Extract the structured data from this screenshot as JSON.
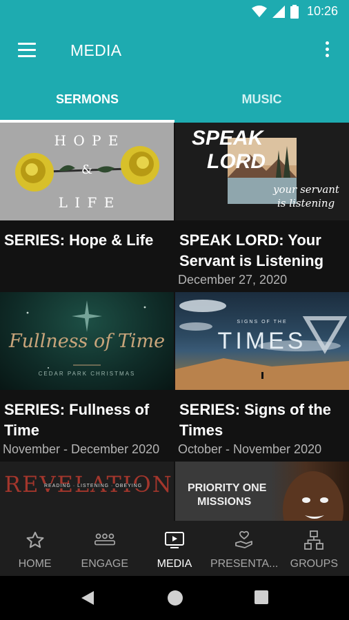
{
  "status_bar": {
    "time": "10:26"
  },
  "app_bar": {
    "title": "MEDIA"
  },
  "tabs": [
    {
      "label": "SERMONS",
      "active": true
    },
    {
      "label": "MUSIC",
      "active": false
    }
  ],
  "cards": [
    {
      "title": "SERIES: Hope & Life",
      "date": "",
      "art_text": [
        "H O P E",
        "&",
        "L I F E"
      ]
    },
    {
      "title": "SPEAK LORD: Your Servant is Listening",
      "date": "December 27, 2020",
      "art_text": [
        "SPEAK",
        "LORD",
        "your servant",
        "is listening"
      ]
    },
    {
      "title": "SERIES: Fullness of Time",
      "date": "November - December 2020",
      "art_text": [
        "Fullness of Time",
        "CEDAR PARK CHRISTMAS"
      ]
    },
    {
      "title": "SERIES: Signs of the Times",
      "date": "October - November 2020",
      "art_text": [
        "SIGNS OF THE",
        "TIMES"
      ]
    },
    {
      "title": "",
      "date": "",
      "art_text": [
        "REVELATION",
        "READING · LISTENING · OBEYING"
      ]
    },
    {
      "title": "",
      "date": "",
      "art_text": [
        "PRIORITY ONE",
        "MISSIONS"
      ]
    }
  ],
  "bottom_nav": [
    {
      "label": "HOME",
      "icon": "star-icon",
      "active": false
    },
    {
      "label": "ENGAGE",
      "icon": "people-icon",
      "active": false
    },
    {
      "label": "MEDIA",
      "icon": "tv-play-icon",
      "active": true
    },
    {
      "label": "PRESENTA...",
      "icon": "hand-heart-icon",
      "active": false
    },
    {
      "label": "GROUPS",
      "icon": "org-chart-icon",
      "active": false
    }
  ],
  "colors": {
    "primary": "#1eabb0",
    "background": "#121212",
    "nav_bg": "#1e1e1e"
  }
}
